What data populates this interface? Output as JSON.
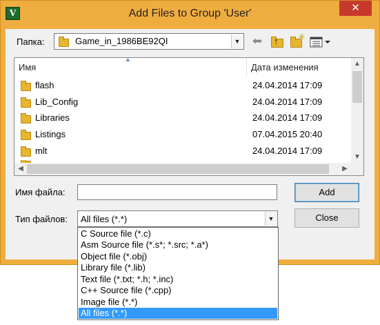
{
  "window": {
    "title": "Add Files to Group 'User'",
    "app_icon_text": "V",
    "close_symbol": "✕"
  },
  "lookin": {
    "label": "Папка:",
    "value": "Game_in_1986BE92QI"
  },
  "toolbar": {
    "back_icon": "back-arrow-icon",
    "up_icon": "up-folder-icon",
    "new_icon": "new-folder-icon",
    "view_icon": "view-menu-icon"
  },
  "file_list": {
    "columns": {
      "name": "Имя",
      "date": "Дата изменения"
    },
    "rows": [
      {
        "name": "flash",
        "date": "24.04.2014 17:09"
      },
      {
        "name": "Lib_Config",
        "date": "24.04.2014 17:09"
      },
      {
        "name": "Libraries",
        "date": "24.04.2014 17:09"
      },
      {
        "name": "Listings",
        "date": "07.04.2015 20:40"
      },
      {
        "name": "mlt",
        "date": "24.04.2014 17:09"
      }
    ]
  },
  "filename": {
    "label": "Имя файла:",
    "value": ""
  },
  "filetype": {
    "label": "Тип файлов:",
    "value": "All files (*.*)",
    "options": [
      "C Source file (*.c)",
      "Asm Source file (*.s*; *.src; *.a*)",
      "Object file (*.obj)",
      "Library file (*.lib)",
      "Text file (*.txt; *.h; *.inc)",
      "C++ Source file (*.cpp)",
      "Image file (*.*)",
      "All files (*.*)"
    ],
    "selected_index": 7
  },
  "buttons": {
    "add": "Add",
    "close": "Close"
  },
  "colors": {
    "frame": "#f0ad3f",
    "close_button": "#c7392b",
    "selection": "#3399ff"
  }
}
